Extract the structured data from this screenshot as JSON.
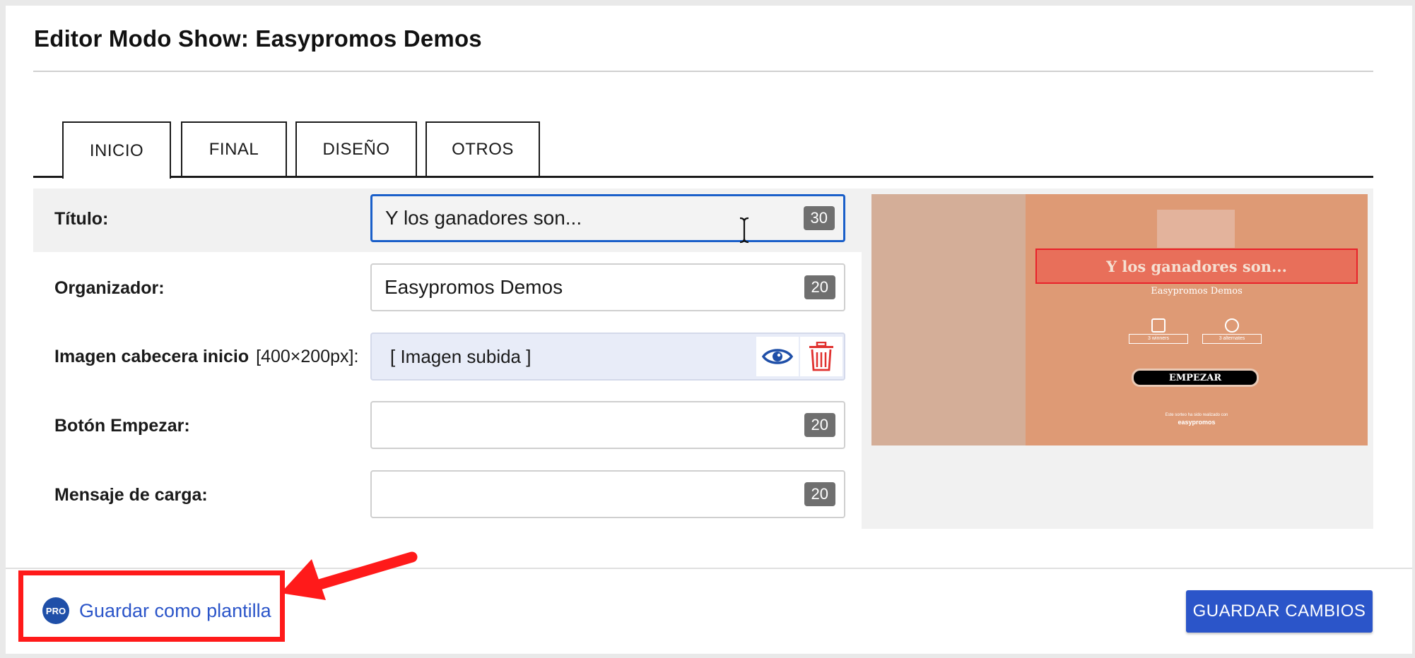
{
  "header": {
    "title": "Editor Modo Show: Easypromos Demos"
  },
  "tabs": [
    {
      "label": "INICIO",
      "active": true
    },
    {
      "label": "FINAL",
      "active": false
    },
    {
      "label": "DISEÑO",
      "active": false
    },
    {
      "label": "OTROS",
      "active": false
    }
  ],
  "form": {
    "titulo": {
      "label": "Título:",
      "value": "Y los ganadores son...",
      "counter": "30"
    },
    "organizador": {
      "label": "Organizador:",
      "value": "Easypromos Demos",
      "counter": "20"
    },
    "imagen": {
      "label": "Imagen cabecera inicio",
      "hint": "[400×200px]:",
      "value": "[ Imagen subida ]"
    },
    "boton": {
      "label": "Botón Empezar:",
      "value": "",
      "counter": "20"
    },
    "mensaje": {
      "label": "Mensaje de carga:",
      "value": "",
      "counter": "20"
    }
  },
  "preview": {
    "title": "Y los ganadores son...",
    "organizer": "Easypromos Demos",
    "stat_1": "3 winners",
    "stat_2": "3 alternates",
    "button": "EMPEZAR",
    "footer_text": "Este sorteo ha sido realizado con",
    "brand": "easypromos"
  },
  "footer": {
    "pro_badge": "PRO",
    "save_template": "Guardar como plantilla",
    "save_changes": "GUARDAR CAMBIOS"
  },
  "colors": {
    "accent": "#2b55c9",
    "annotation": "#ff1a1a",
    "delete": "#e0302e"
  }
}
